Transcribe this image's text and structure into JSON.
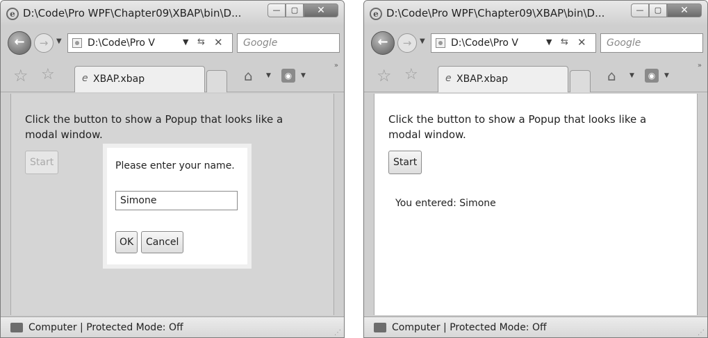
{
  "window_title": "D:\\Code\\Pro WPF\\Chapter09\\XBAP\\bin\\D...",
  "window_buttons": {
    "minimize": "—",
    "maximize": "▢",
    "close": "✕"
  },
  "address": "D:\\Code\\Pro V",
  "search_placeholder": "Google",
  "tab_label": "XBAP.xbap",
  "instruction": "Click the button to show a Popup that looks like a modal window.",
  "start_label": "Start",
  "popup": {
    "prompt": "Please enter your name.",
    "input_value": "Simone",
    "ok_label": "OK",
    "cancel_label": "Cancel"
  },
  "result_text": "You entered: Simone",
  "status_text": "Computer | Protected Mode: Off",
  "icons": [
    "ie-logo-icon",
    "back-icon",
    "forward-icon",
    "page-icon",
    "refresh-icon",
    "stop-icon",
    "favorites-star-icon",
    "add-favorites-icon",
    "home-icon",
    "rss-icon",
    "computer-icon"
  ]
}
